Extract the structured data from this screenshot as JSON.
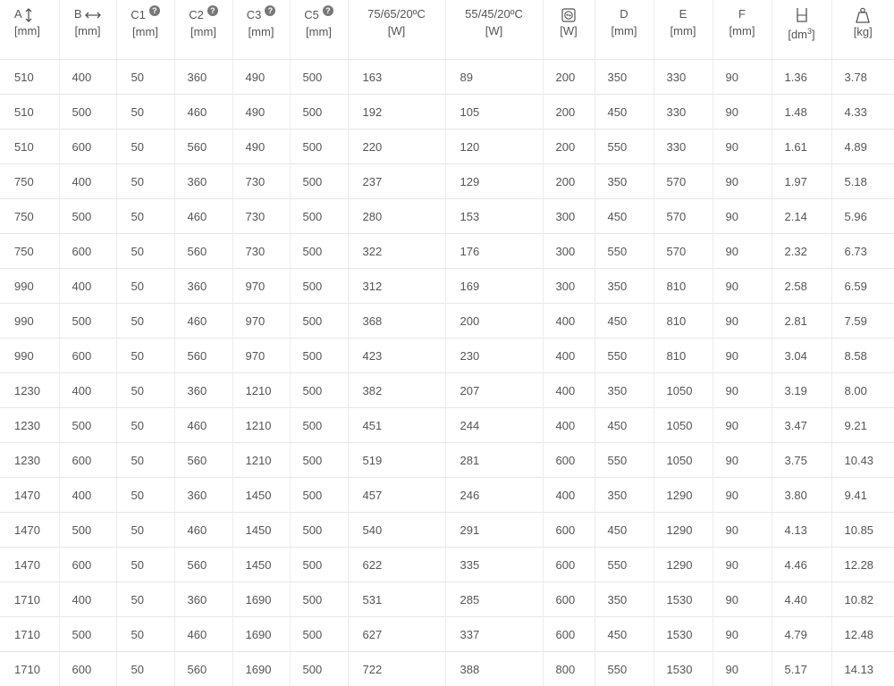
{
  "columns": [
    {
      "key": "a",
      "label": "A",
      "unit": "[mm]",
      "icon": "vertical-arrow-icon",
      "help": false
    },
    {
      "key": "b",
      "label": "B",
      "unit": "[mm]",
      "icon": "horizontal-arrow-icon",
      "help": false
    },
    {
      "key": "c1",
      "label": "C1",
      "unit": "[mm]",
      "help": true
    },
    {
      "key": "c2",
      "label": "C2",
      "unit": "[mm]",
      "help": true
    },
    {
      "key": "c3",
      "label": "C3",
      "unit": "[mm]",
      "help": true
    },
    {
      "key": "c5",
      "label": "C5",
      "unit": "[mm]",
      "help": true
    },
    {
      "key": "p75",
      "label": "75/65/20ºC",
      "unit": "[W]",
      "help": false
    },
    {
      "key": "p55",
      "label": "55/45/20ºC",
      "unit": "[W]",
      "help": false
    },
    {
      "key": "el",
      "label": "",
      "unit": "[W]",
      "icon": "electric-heater-icon",
      "help": false
    },
    {
      "key": "d",
      "label": "D",
      "unit": "[mm]",
      "help": false
    },
    {
      "key": "e",
      "label": "E",
      "unit": "[mm]",
      "help": false
    },
    {
      "key": "f",
      "label": "F",
      "unit": "[mm]",
      "help": false
    },
    {
      "key": "vol",
      "label": "",
      "unit": "[dm",
      "unit_sup": "3",
      "unit_end": "]",
      "icon": "water-volume-icon",
      "help": false
    },
    {
      "key": "kg",
      "label": "",
      "unit": "[kg]",
      "icon": "weight-icon",
      "help": false
    }
  ],
  "help_glyph": "?",
  "rows": [
    [
      "510",
      "400",
      "50",
      "360",
      "490",
      "500",
      "163",
      "89",
      "200",
      "350",
      "330",
      "90",
      "1.36",
      "3.78"
    ],
    [
      "510",
      "500",
      "50",
      "460",
      "490",
      "500",
      "192",
      "105",
      "200",
      "450",
      "330",
      "90",
      "1.48",
      "4.33"
    ],
    [
      "510",
      "600",
      "50",
      "560",
      "490",
      "500",
      "220",
      "120",
      "200",
      "550",
      "330",
      "90",
      "1.61",
      "4.89"
    ],
    [
      "750",
      "400",
      "50",
      "360",
      "730",
      "500",
      "237",
      "129",
      "200",
      "350",
      "570",
      "90",
      "1.97",
      "5.18"
    ],
    [
      "750",
      "500",
      "50",
      "460",
      "730",
      "500",
      "280",
      "153",
      "300",
      "450",
      "570",
      "90",
      "2.14",
      "5.96"
    ],
    [
      "750",
      "600",
      "50",
      "560",
      "730",
      "500",
      "322",
      "176",
      "300",
      "550",
      "570",
      "90",
      "2.32",
      "6.73"
    ],
    [
      "990",
      "400",
      "50",
      "360",
      "970",
      "500",
      "312",
      "169",
      "300",
      "350",
      "810",
      "90",
      "2.58",
      "6.59"
    ],
    [
      "990",
      "500",
      "50",
      "460",
      "970",
      "500",
      "368",
      "200",
      "400",
      "450",
      "810",
      "90",
      "2.81",
      "7.59"
    ],
    [
      "990",
      "600",
      "50",
      "560",
      "970",
      "500",
      "423",
      "230",
      "400",
      "550",
      "810",
      "90",
      "3.04",
      "8.58"
    ],
    [
      "1230",
      "400",
      "50",
      "360",
      "1210",
      "500",
      "382",
      "207",
      "400",
      "350",
      "1050",
      "90",
      "3.19",
      "8.00"
    ],
    [
      "1230",
      "500",
      "50",
      "460",
      "1210",
      "500",
      "451",
      "244",
      "400",
      "450",
      "1050",
      "90",
      "3.47",
      "9.21"
    ],
    [
      "1230",
      "600",
      "50",
      "560",
      "1210",
      "500",
      "519",
      "281",
      "600",
      "550",
      "1050",
      "90",
      "3.75",
      "10.43"
    ],
    [
      "1470",
      "400",
      "50",
      "360",
      "1450",
      "500",
      "457",
      "246",
      "400",
      "350",
      "1290",
      "90",
      "3.80",
      "9.41"
    ],
    [
      "1470",
      "500",
      "50",
      "460",
      "1450",
      "500",
      "540",
      "291",
      "600",
      "450",
      "1290",
      "90",
      "4.13",
      "10.85"
    ],
    [
      "1470",
      "600",
      "50",
      "560",
      "1450",
      "500",
      "622",
      "335",
      "600",
      "550",
      "1290",
      "90",
      "4.46",
      "12.28"
    ],
    [
      "1710",
      "400",
      "50",
      "360",
      "1690",
      "500",
      "531",
      "285",
      "600",
      "350",
      "1530",
      "90",
      "4.40",
      "10.82"
    ],
    [
      "1710",
      "500",
      "50",
      "460",
      "1690",
      "500",
      "627",
      "337",
      "600",
      "450",
      "1530",
      "90",
      "4.79",
      "12.48"
    ],
    [
      "1710",
      "600",
      "50",
      "560",
      "1690",
      "500",
      "722",
      "388",
      "800",
      "550",
      "1530",
      "90",
      "5.17",
      "14.13"
    ]
  ]
}
